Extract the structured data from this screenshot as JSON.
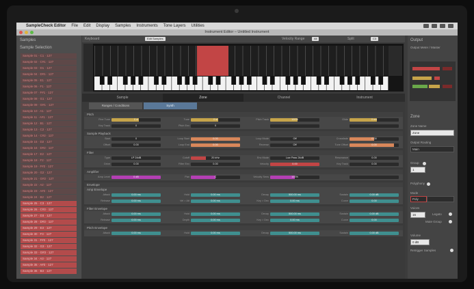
{
  "menubar": {
    "apple": "",
    "app_name": "SampleCheck Editor",
    "items": [
      "File",
      "Edit",
      "Display",
      "Samples",
      "Instruments",
      "Tone Layers",
      "Utilities"
    ]
  },
  "window": {
    "title": "Instrument Editor – Untitled Instrument"
  },
  "sidebar_left": {
    "title": "Samples",
    "subtitle": "Sample Selection",
    "items": [
      "Sample 01 · C1 · 127",
      "Sample 02 · C#1 · 127",
      "Sample 03 · D1 · 127",
      "Sample 04 · D#1 · 127",
      "Sample 05 · E1 · 127",
      "Sample 06 · F1 · 127",
      "Sample 07 · F#1 · 127",
      "Sample 08 · G1 · 127",
      "Sample 09 · G#1 · 127",
      "Sample 10 · A1 · 127",
      "Sample 11 · A#1 · 127",
      "Sample 12 · B1 · 127",
      "Sample 13 · C2 · 127",
      "Sample 14 · C#2 · 127",
      "Sample 15 · D2 · 127",
      "Sample 16 · D#2 · 127",
      "Sample 17 · E2 · 127",
      "Sample 18 · F2 · 127",
      "Sample 19 · F#2 · 127",
      "Sample 20 · G2 · 127",
      "Sample 21 · G#2 · 127",
      "Sample 22 · A2 · 127",
      "Sample 23 · A#2 · 127",
      "Sample 24 · B2 · 127",
      "Sample 25 · C3 · 127",
      "Sample 26 · C#3 · 127",
      "Sample 27 · D3 · 127",
      "Sample 28 · D#3 · 127",
      "Sample 29 · E3 · 127",
      "Sample 30 · F3 · 127",
      "Sample 31 · F#3 · 127",
      "Sample 32 · G3 · 127",
      "Sample 33 · G#3 · 127",
      "Sample 34 · A3 · 127",
      "Sample 35 · A#3 · 127",
      "Sample 36 · B3 · 127"
    ],
    "selected_from": 24
  },
  "keyboard": {
    "title": "Keyboard",
    "dropdown": "Edit Samples",
    "range_label": "Velocity Range",
    "range_value": "All",
    "split_label": "Split",
    "split_value": "C3"
  },
  "tabs": [
    "Sample",
    "Zone",
    "Channel",
    "Instrument"
  ],
  "active_tab": 1,
  "subtabs": [
    "Ranges / Conditions",
    "Synth"
  ],
  "active_subtab": 1,
  "sections": [
    {
      "title": "Pitch",
      "rows": [
        [
          {
            "label": "Fine Tune",
            "value": "0 ct",
            "fill": 0.55,
            "color": "#c6a44a"
          },
          {
            "label": "Tune",
            "value": "0 st",
            "fill": 0.55,
            "color": "#c6a44a"
          },
          {
            "label": "Pitch Track",
            "value": "100%",
            "fill": 0.55,
            "color": "#c6a44a"
          },
          {
            "label": "Glide",
            "value": "0 ms",
            "fill": 0.55,
            "color": "#c6a44a"
          }
        ],
        [
          {
            "label": "Key Track",
            "value": "0",
            "fill": 0.0,
            "color": "#c6a44a"
          },
          {
            "label": "Pitch Env",
            "value": "0",
            "fill": 0.0,
            "color": "#c6a44a"
          },
          {
            "label": "",
            "value": "",
            "fill": 0.0,
            "color": "#c6a44a"
          },
          {
            "label": "",
            "value": "",
            "fill": 0.0,
            "color": "#c6a44a"
          }
        ]
      ]
    },
    {
      "title": "Sample Playback",
      "rows": [
        [
          {
            "label": "Start",
            "value": "0",
            "fill": 0.0,
            "color": "#d8875a"
          },
          {
            "label": "Loop Start",
            "value": "0.00",
            "fill": 1.0,
            "color": "#d8875a"
          },
          {
            "label": "Loop Mode",
            "value": "Off",
            "fill": 0.0,
            "color": "#d8875a"
          },
          {
            "label": "Crossfade",
            "value": "0.00",
            "fill": 0.5,
            "color": "#d8875a"
          }
        ],
        [
          {
            "label": "Offset",
            "value": "0.00",
            "fill": 0.0,
            "color": "#d8875a"
          },
          {
            "label": "Loop End",
            "value": "0.00",
            "fill": 1.0,
            "color": "#d8875a"
          },
          {
            "label": "Reverse",
            "value": "Off",
            "fill": 0.0,
            "color": "#d8875a"
          },
          {
            "label": "Tune Offset",
            "value": "0.00",
            "fill": 0.9,
            "color": "#d8875a"
          }
        ]
      ]
    },
    {
      "title": "Filter",
      "rows": [
        [
          {
            "label": "Type",
            "value": "LP 24dB",
            "fill": 0.0,
            "color": "#c24545"
          },
          {
            "label": "Cutoff",
            "value": "20 kHz",
            "fill": 0.3,
            "color": "#c24545"
          },
          {
            "label": "Env Mode",
            "value": "Low Pass 24dB",
            "fill": 0.0,
            "color": "#c24545"
          },
          {
            "label": "Resonance",
            "value": "0.00",
            "fill": 0.0,
            "color": "#c24545"
          }
        ],
        [
          {
            "label": "Drive",
            "value": "0.00",
            "fill": 0.0,
            "color": "#c24545"
          },
          {
            "label": "Filter Env",
            "value": "0.00",
            "fill": 0.0,
            "color": "#c24545"
          },
          {
            "label": "Velocity",
            "value": "0.00",
            "fill": 1.0,
            "color": "#c24545"
          },
          {
            "label": "Key Track",
            "value": "0.00",
            "fill": 0.0,
            "color": "#c24545"
          }
        ]
      ]
    },
    {
      "title": "Amplifier",
      "rows": [
        [
          {
            "label": "Amp Level",
            "value": "0 dB",
            "fill": 1.0,
            "color": "#b43fb4"
          },
          {
            "label": "Pan",
            "value": "C",
            "fill": 0.5,
            "color": "#b43fb4"
          },
          {
            "label": "Velocity Sens",
            "value": "100%",
            "fill": 0.5,
            "color": "#b43fb4"
          },
          {
            "label": "",
            "value": "",
            "fill": 0.0,
            "color": "#b43fb4"
          }
        ]
      ]
    },
    {
      "title": "Envelope",
      "subtitle": "Amp Envelope",
      "rows": [
        [
          {
            "label": "Attack",
            "value": "0.00 ms",
            "fill": 1.0,
            "color": "#3f8f8f"
          },
          {
            "label": "Hold",
            "value": "0.00 ms",
            "fill": 1.0,
            "color": "#3f8f8f"
          },
          {
            "label": "Decay",
            "value": "500.00 ms",
            "fill": 1.0,
            "color": "#3f8f8f"
          },
          {
            "label": "Sustain",
            "value": "0.00 dB",
            "fill": 1.0,
            "color": "#3f8f8f"
          }
        ],
        [
          {
            "label": "Release",
            "value": "0.00 ms",
            "fill": 1.0,
            "color": "#3f8f8f"
          },
          {
            "label": "Vel > Att",
            "value": "0.00 ms",
            "fill": 1.0,
            "color": "#3f8f8f"
          },
          {
            "label": "Key > Dec",
            "value": "0.00 ms",
            "fill": 1.0,
            "color": "#3f8f8f"
          },
          {
            "label": "Curve",
            "value": "0.00",
            "fill": 1.0,
            "color": "#3f8f8f"
          }
        ]
      ]
    },
    {
      "title": "Filter Envelope",
      "rows": [
        [
          {
            "label": "Attack",
            "value": "0.00 ms",
            "fill": 1.0,
            "color": "#3f8f8f"
          },
          {
            "label": "Hold",
            "value": "0.00 ms",
            "fill": 1.0,
            "color": "#3f8f8f"
          },
          {
            "label": "Decay",
            "value": "500.00 ms",
            "fill": 1.0,
            "color": "#3f8f8f"
          },
          {
            "label": "Sustain",
            "value": "0.00 dB",
            "fill": 1.0,
            "color": "#3f8f8f"
          }
        ],
        [
          {
            "label": "Release",
            "value": "0.00 ms",
            "fill": 1.0,
            "color": "#3f8f8f"
          },
          {
            "label": "Depth",
            "value": "0.00 ms",
            "fill": 1.0,
            "color": "#3f8f8f"
          },
          {
            "label": "Key > Dec",
            "value": "0.00 ms",
            "fill": 1.0,
            "color": "#3f8f8f"
          },
          {
            "label": "Curve",
            "value": "0.00",
            "fill": 1.0,
            "color": "#3f8f8f"
          }
        ]
      ]
    },
    {
      "title": "Pitch Envelope",
      "rows": [
        [
          {
            "label": "Attack",
            "value": "0.00 ms",
            "fill": 1.0,
            "color": "#3f8f8f"
          },
          {
            "label": "Hold",
            "value": "0.00 ms",
            "fill": 1.0,
            "color": "#3f8f8f"
          },
          {
            "label": "Decay",
            "value": "500.00 ms",
            "fill": 1.0,
            "color": "#3f8f8f"
          },
          {
            "label": "Sustain",
            "value": "0.00 dB",
            "fill": 1.0,
            "color": "#3f8f8f"
          }
        ]
      ]
    }
  ],
  "sidebar_right": {
    "title": "Output",
    "meter_label": "Output Meter / Master",
    "controls_title": "Zone",
    "name_label": "Zone Name",
    "name_value": "Zone",
    "output_label": "Output Routing",
    "output_value": "Main",
    "group_label": "Group",
    "group_value": "1",
    "polyphony_label": "Polyphony",
    "mode_label": "Mode",
    "mode_value": "Poly",
    "voices_label": "Voices",
    "voices_value": "16",
    "legato_label": "Legato",
    "mute_label": "Mute Group",
    "volume_label": "Volume",
    "volume_value": "0 dB",
    "retrigger_label": "Retrigger Samples"
  }
}
